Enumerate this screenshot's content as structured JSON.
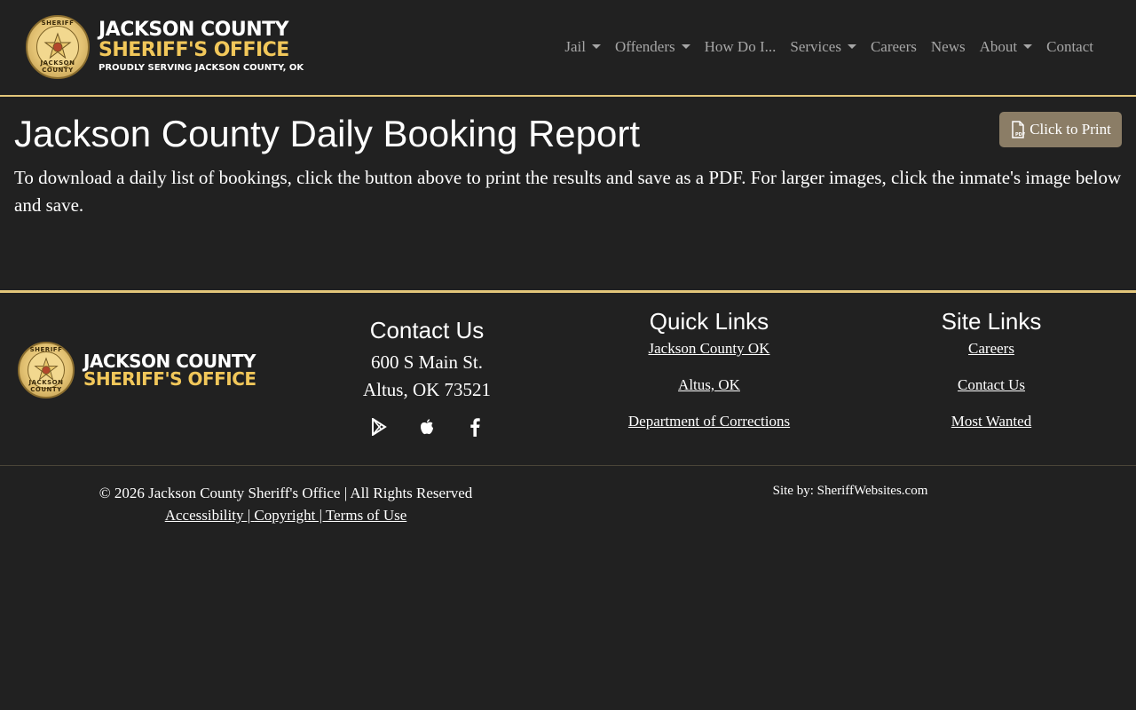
{
  "header": {
    "logo": {
      "badge_top": "SHERIFF",
      "badge_bottom": "JACKSON COUNTY",
      "line1": "JACKSON COUNTY",
      "line2": "SHERIFF'S OFFICE",
      "line3": "PROUDLY SERVING JACKSON COUNTY, OK"
    },
    "nav": [
      {
        "label": "Jail",
        "dropdown": true
      },
      {
        "label": "Offenders",
        "dropdown": true
      },
      {
        "label": "How Do I...",
        "dropdown": false
      },
      {
        "label": "Services",
        "dropdown": true
      },
      {
        "label": "Careers",
        "dropdown": false
      },
      {
        "label": "News",
        "dropdown": false
      },
      {
        "label": "About",
        "dropdown": true
      },
      {
        "label": "Contact",
        "dropdown": false
      }
    ]
  },
  "main": {
    "title": "Jackson County Daily Booking Report",
    "print_button": "Click to Print",
    "intro": "To download a daily list of bookings, click the button above to print the results and save as a PDF. For larger images, click the inmate's image below and save."
  },
  "footer": {
    "logo": {
      "badge_top": "SHERIFF",
      "badge_bottom": "JACKSON COUNTY",
      "line1": "JACKSON COUNTY",
      "line2": "SHERIFF'S OFFICE"
    },
    "contact": {
      "heading": "Contact Us",
      "address1": "600 S Main St.",
      "address2": "Altus, OK 73521",
      "social": [
        "google-play-icon",
        "apple-icon",
        "facebook-icon"
      ]
    },
    "quick_links": {
      "heading": "Quick Links",
      "items": [
        "Jackson County OK",
        "Altus, OK",
        "Department of Corrections"
      ]
    },
    "site_links": {
      "heading": "Site Links",
      "items": [
        "Careers",
        "Contact Us",
        "Most Wanted"
      ]
    },
    "copyright": "© 2026 Jackson County Sheriff's Office | All Rights Reserved",
    "legal_links": [
      "Accessibility | ",
      "Copyright | ",
      "Terms of Use"
    ],
    "site_by": "Site by: SheriffWebsites.com"
  },
  "colors": {
    "background": "#212121",
    "gold": "#e3c67a",
    "logo_gold": "#f1c75a",
    "button": "#8b7d66",
    "nav_text": "#a6a6a6"
  }
}
